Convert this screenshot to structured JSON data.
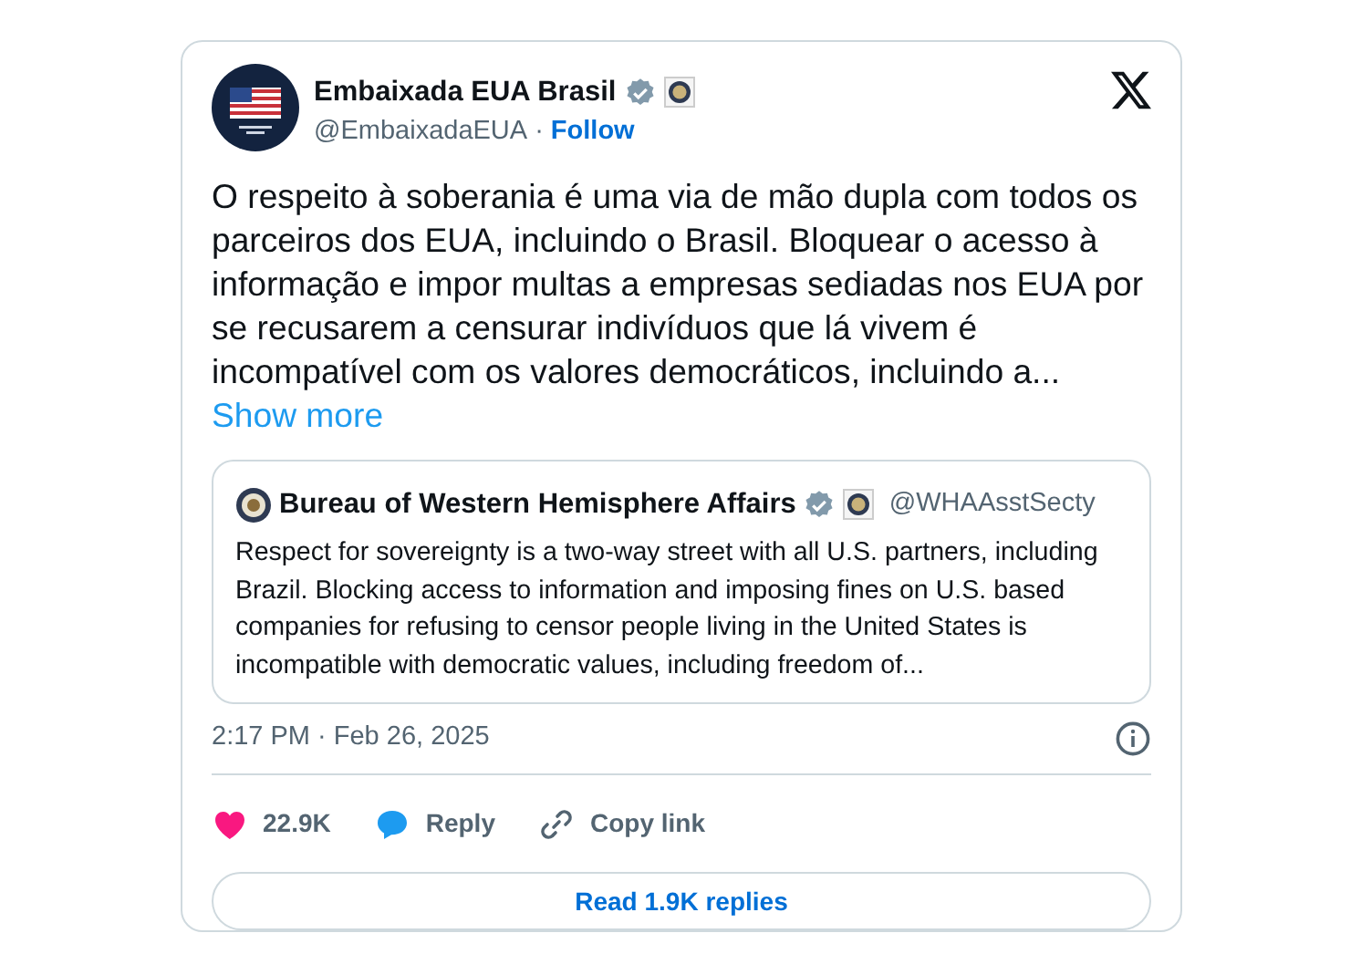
{
  "author": {
    "name": "Embaixada EUA Brasil",
    "handle": "@EmbaixadaEUA",
    "separator": "·",
    "follow": "Follow"
  },
  "text": "O respeito à soberania é uma via de mão dupla com todos os parceiros dos EUA, incluindo o Brasil. Bloquear o acesso à informação e impor multas a empresas sediadas nos EUA por se recusarem a censurar indivíduos que lá vivem é incompatível com os valores democráticos, incluindo a...",
  "show_more": "Show more",
  "quote": {
    "name": "Bureau of Western Hemisphere Affairs",
    "handle": "@WHAAsstSecty",
    "text": "Respect for sovereignty is a two-way street with all U.S. partners, including Brazil. Blocking access to information and imposing fines on U.S. based companies for refusing to censor people living in the United States is incompatible with democratic values, including freedom of..."
  },
  "timestamp": "2:17 PM · Feb 26, 2025",
  "actions": [
    {
      "kind": "like",
      "label": "22.9K"
    },
    {
      "kind": "reply",
      "label": "Reply"
    },
    {
      "kind": "copy",
      "label": "Copy link"
    }
  ],
  "replies_button": "Read 1.9K replies"
}
